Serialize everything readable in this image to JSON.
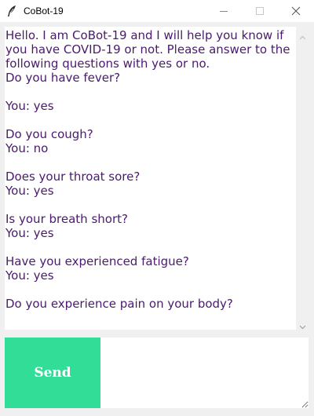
{
  "window": {
    "title": "CoBot-19",
    "app_icon": "feather-icon",
    "controls": [
      "minimize-icon",
      "maximize-icon",
      "close-icon"
    ]
  },
  "chat": {
    "transcript": "Hello. I am CoBot-19 and I will help you know if you have COVID-19 or not. Please answer to the following questions with yes or no.\nDo you have fever?\n\nYou: yes\n\nDo you cough?\nYou: no\n\nDoes your throat sore?\nYou: yes\n\nIs your breath short?\nYou: yes\n\nHave you experienced fatigue?\nYou: yes\n\nDo you experience pain on your body?"
  },
  "input": {
    "value": "",
    "send_label": "Send"
  },
  "colors": {
    "chat_text": "#4a1a6e",
    "send_button": "#32de97",
    "send_text": "#ffffff"
  }
}
